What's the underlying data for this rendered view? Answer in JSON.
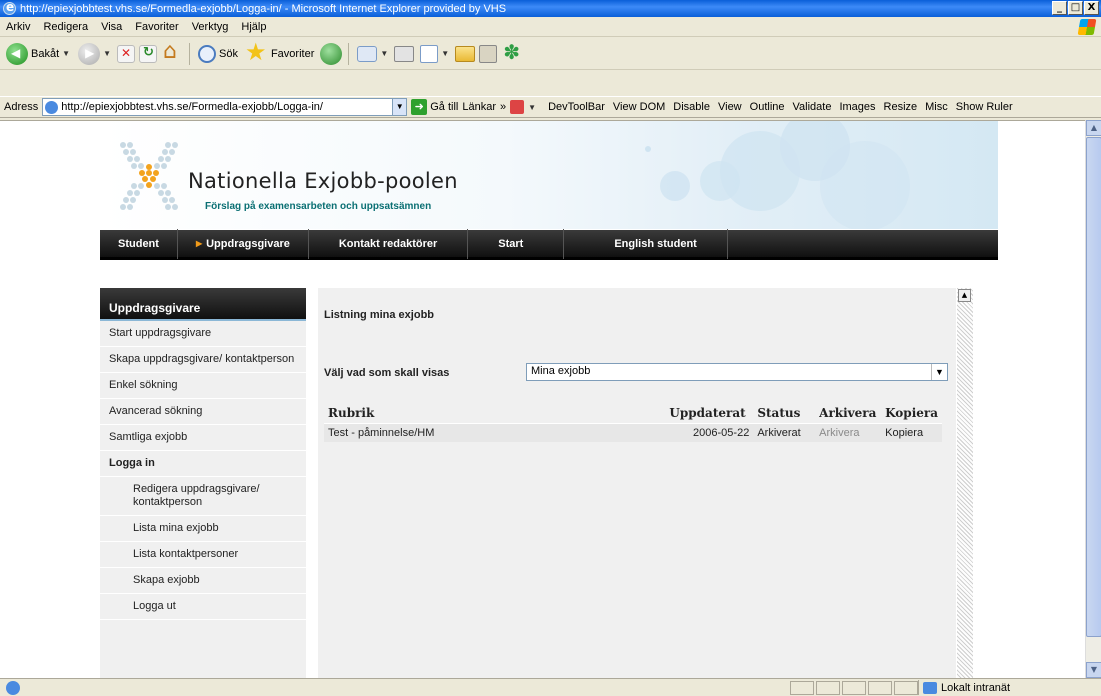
{
  "window": {
    "title": "http://epiexjobbtest.vhs.se/Formedla-exjobb/Logga-in/ - Microsoft Internet Explorer provided by VHS",
    "controls": [
      "_",
      "□",
      "X"
    ]
  },
  "menu": [
    "Arkiv",
    "Redigera",
    "Visa",
    "Favoriter",
    "Verktyg",
    "Hjälp"
  ],
  "toolbar": {
    "back": "Bakåt",
    "search": "Sök",
    "favorites": "Favoriter"
  },
  "addressbar": {
    "label": "Adress",
    "url": "http://epiexjobbtest.vhs.se/Formedla-exjobb/Logga-in/",
    "go": "Gå till",
    "links": "Länkar",
    "devtools": [
      "DevToolBar",
      "View DOM",
      "Disable",
      "View",
      "Outline",
      "Validate",
      "Images",
      "Resize",
      "Misc",
      "Show Ruler"
    ]
  },
  "site": {
    "title": "Nationella Exjobb-poolen",
    "subtitle": "Förslag på examensarbeten och uppsatsämnen",
    "nav": [
      "Student",
      "Uppdragsgivare",
      "Kontakt redaktörer",
      "Start",
      "English student"
    ]
  },
  "sidebar": {
    "heading": "Uppdragsgivare",
    "items": [
      {
        "label": "Start uppdragsgivare",
        "type": "normal"
      },
      {
        "label": "Skapa uppdragsgivare/ kontaktperson",
        "type": "normal"
      },
      {
        "label": "Enkel sökning",
        "type": "normal"
      },
      {
        "label": "Avancerad sökning",
        "type": "normal"
      },
      {
        "label": "Samtliga exjobb",
        "type": "normal"
      },
      {
        "label": "Logga in",
        "type": "bold"
      },
      {
        "label": "Redigera uppdragsgivare/ kontaktperson",
        "type": "sub"
      },
      {
        "label": "Lista mina exjobb",
        "type": "sub"
      },
      {
        "label": "Lista kontaktpersoner",
        "type": "sub"
      },
      {
        "label": "Skapa exjobb",
        "type": "sub"
      },
      {
        "label": "Logga ut",
        "type": "sub"
      }
    ]
  },
  "main": {
    "heading": "Listning mina exjobb",
    "select_label": "Välj vad som skall visas",
    "select_value": "Mina exjobb",
    "table": {
      "headers": [
        "Rubrik",
        "Uppdaterat",
        "Status",
        "Arkivera",
        "Kopiera"
      ],
      "rows": [
        [
          "Test - påminnelse/HM",
          "2006-05-22",
          "Arkiverat",
          "Arkivera",
          "Kopiera"
        ]
      ]
    }
  },
  "status": {
    "zone": "Lokalt intranät"
  }
}
